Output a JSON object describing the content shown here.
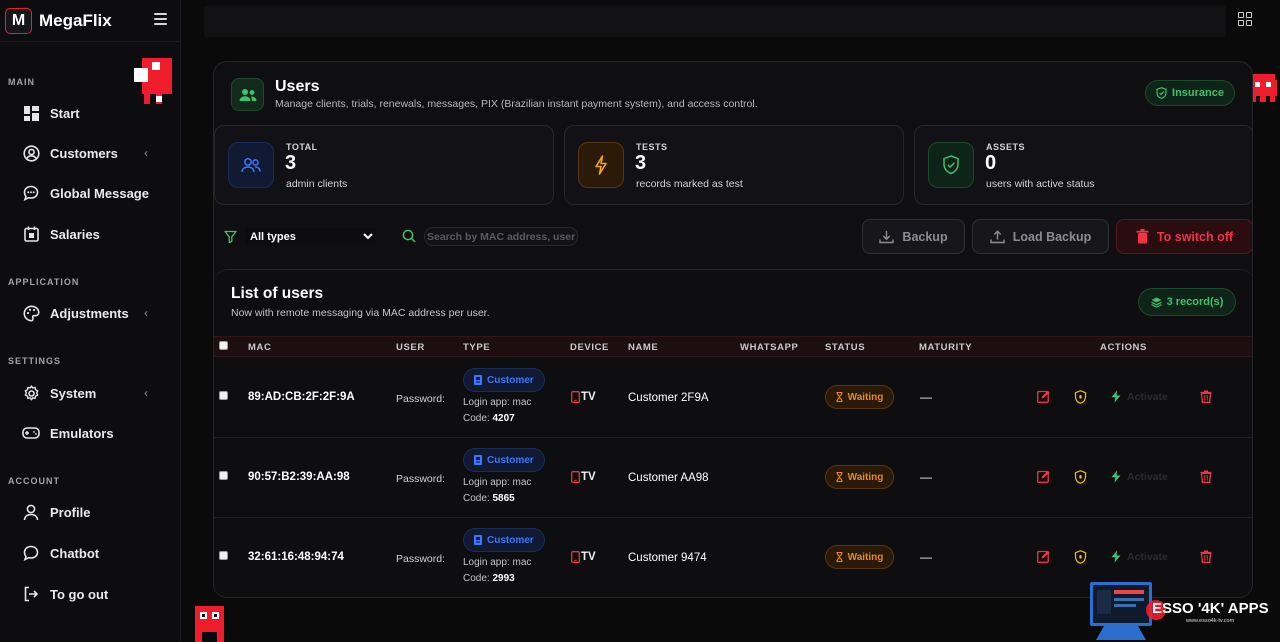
{
  "brand": {
    "logo_letter": "M",
    "name": "MegaFlix"
  },
  "sidebar": {
    "sections": {
      "main": "MAIN",
      "application": "APPLICATION",
      "settings": "SETTINGS",
      "account": "ACCOUNT"
    },
    "items": {
      "start": "Start",
      "customers": "Customers",
      "global_message": "Global Message",
      "salaries": "Salaries",
      "adjustments": "Adjustments",
      "system": "System",
      "emulators": "Emulators",
      "profile": "Profile",
      "chatbot": "Chatbot",
      "logout": "To go out"
    }
  },
  "header": {
    "title": "Users",
    "subtitle": "Manage clients, trials, renewals, messages, PIX (Brazilian instant payment system), and access control.",
    "insurance_label": "Insurance"
  },
  "stats": [
    {
      "label": "TOTAL",
      "value": "3",
      "desc": "admin clients"
    },
    {
      "label": "TESTS",
      "value": "3",
      "desc": "records marked as test"
    },
    {
      "label": "ASSETS",
      "value": "0",
      "desc": "users with active status"
    }
  ],
  "filters": {
    "type_selected": "All types",
    "search_placeholder": "Search by MAC address, user"
  },
  "actions": {
    "backup": "Backup",
    "load_backup": "Load Backup",
    "switch_off": "To switch off"
  },
  "list": {
    "title": "List of users",
    "subtitle": "Now with remote messaging via MAC address per user.",
    "records_badge": "3 record(s)",
    "columns": [
      "MAC",
      "USER",
      "TYPE",
      "DEVICE",
      "NAME",
      "WHATSAPP",
      "STATUS",
      "MATURITY",
      "ACTIONS"
    ],
    "rows": [
      {
        "mac": "89:AD:CB:2F:2F:9A",
        "user": "Password:",
        "type": "Customer",
        "login_app": "Login app: mac",
        "code_label": "Code:",
        "code": "4207",
        "device": "TV",
        "name": "Customer 2F9A",
        "whatsapp": "",
        "status": "Waiting",
        "maturity": "—",
        "activate": "Activate"
      },
      {
        "mac": "90:57:B2:39:AA:98",
        "user": "Password:",
        "type": "Customer",
        "login_app": "Login app: mac",
        "code_label": "Code:",
        "code": "5865",
        "device": "TV",
        "name": "Customer AA98",
        "whatsapp": "",
        "status": "Waiting",
        "maturity": "—",
        "activate": "Activate"
      },
      {
        "mac": "32:61:16:48:94:74",
        "user": "Password:",
        "type": "Customer",
        "login_app": "Login app: mac",
        "code_label": "Code:",
        "code": "2993",
        "device": "TV",
        "name": "Customer 9474",
        "whatsapp": "",
        "status": "Waiting",
        "maturity": "—",
        "activate": "Activate"
      }
    ]
  },
  "watermark": {
    "text": "ESSO '4K' APPS",
    "url": "www.esso4k-tv.com"
  },
  "colors": {
    "accent_red": "#ef1c2c",
    "green": "#3ec26a",
    "blue": "#3a78ff",
    "orange": "#e5892b",
    "yellow": "#f2b705"
  }
}
